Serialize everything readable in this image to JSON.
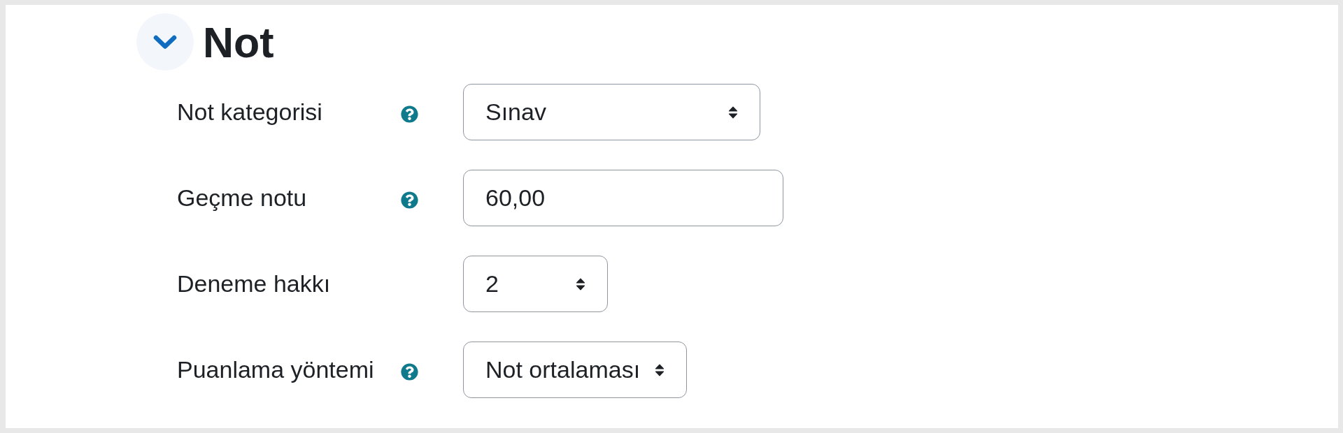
{
  "section": {
    "title": "Not",
    "expanded": true
  },
  "fields": [
    {
      "kind": "select",
      "label": "Not kategorisi",
      "help": true,
      "value": "Sınav"
    },
    {
      "kind": "text",
      "label": "Geçme notu",
      "help": true,
      "value": "60,00"
    },
    {
      "kind": "select",
      "label": "Deneme hakkı",
      "help": false,
      "value": "2"
    },
    {
      "kind": "select",
      "label": "Puanlama yöntemi",
      "help": true,
      "value": "Not ortalaması"
    }
  ]
}
